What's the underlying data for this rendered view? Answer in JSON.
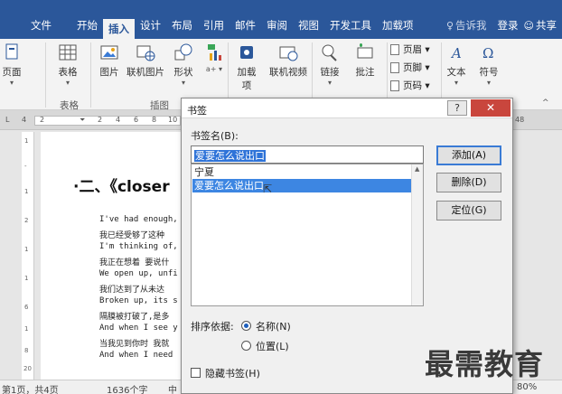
{
  "tabs": {
    "file": "文件",
    "home": "开始",
    "insert": "插入",
    "design": "设计",
    "layout": "布局",
    "references": "引用",
    "mailings": "邮件",
    "review": "审阅",
    "view": "视图",
    "developer": "开发工具",
    "addins": "加载项",
    "tell_me": "告诉我",
    "login": "登录",
    "share": "共享"
  },
  "ribbon": {
    "page": "页面",
    "table": "表格",
    "picture": "图片",
    "online_picture": "联机图片",
    "shapes": "形状",
    "addins": "加载",
    "addins_2": "项",
    "online_video": "联机视频",
    "link": "链接",
    "comment": "批注",
    "header": "页眉",
    "footer": "页脚",
    "page_number": "页码",
    "text": "文本",
    "symbol": "符号",
    "group_table": "表格",
    "group_illustrations": "插图"
  },
  "ruler": {
    "ticks": [
      "L",
      "4",
      "2",
      "2",
      "4",
      "6",
      "8",
      "10"
    ],
    "right_tick": "48"
  },
  "vruler": {
    "ticks": [
      "1",
      "-",
      "1",
      "2",
      "1",
      "1",
      "6",
      "1",
      "8",
      "20"
    ]
  },
  "document": {
    "heading": "·二、《closer",
    "lines": [
      "I've had enough,",
      "我已经受够了这种",
      "I'm thinking of,",
      "我正在想着 要说什",
      "We open up, unfi",
      "我们达到了从未达",
      "Broken up, its s",
      "隔膜被打破了,是多",
      "And when I see y",
      "当我见到你时 我就",
      "And when I need"
    ]
  },
  "status": {
    "page": "第1页，共4页",
    "words": "1636个字",
    "lang": "中",
    "zoom": "80%"
  },
  "dialog": {
    "title": "书签",
    "help": "?",
    "close": "✕",
    "name_label": "书签名(B):",
    "name_value": "爱要怎么说出口",
    "list": [
      "宁夏",
      "爱要怎么说出口"
    ],
    "selected_index": 1,
    "add_button": "添加(A)",
    "delete_button": "删除(D)",
    "goto_button": "定位(G)",
    "sort_label": "排序依据:",
    "sort_name": "名称(N)",
    "sort_location": "位置(L)",
    "hidden_label": "隐藏书签(H)"
  },
  "watermark": "最需教育",
  "colors": {
    "accent": "#2b579a",
    "selection": "#3d86e2",
    "close": "#c9463d"
  }
}
